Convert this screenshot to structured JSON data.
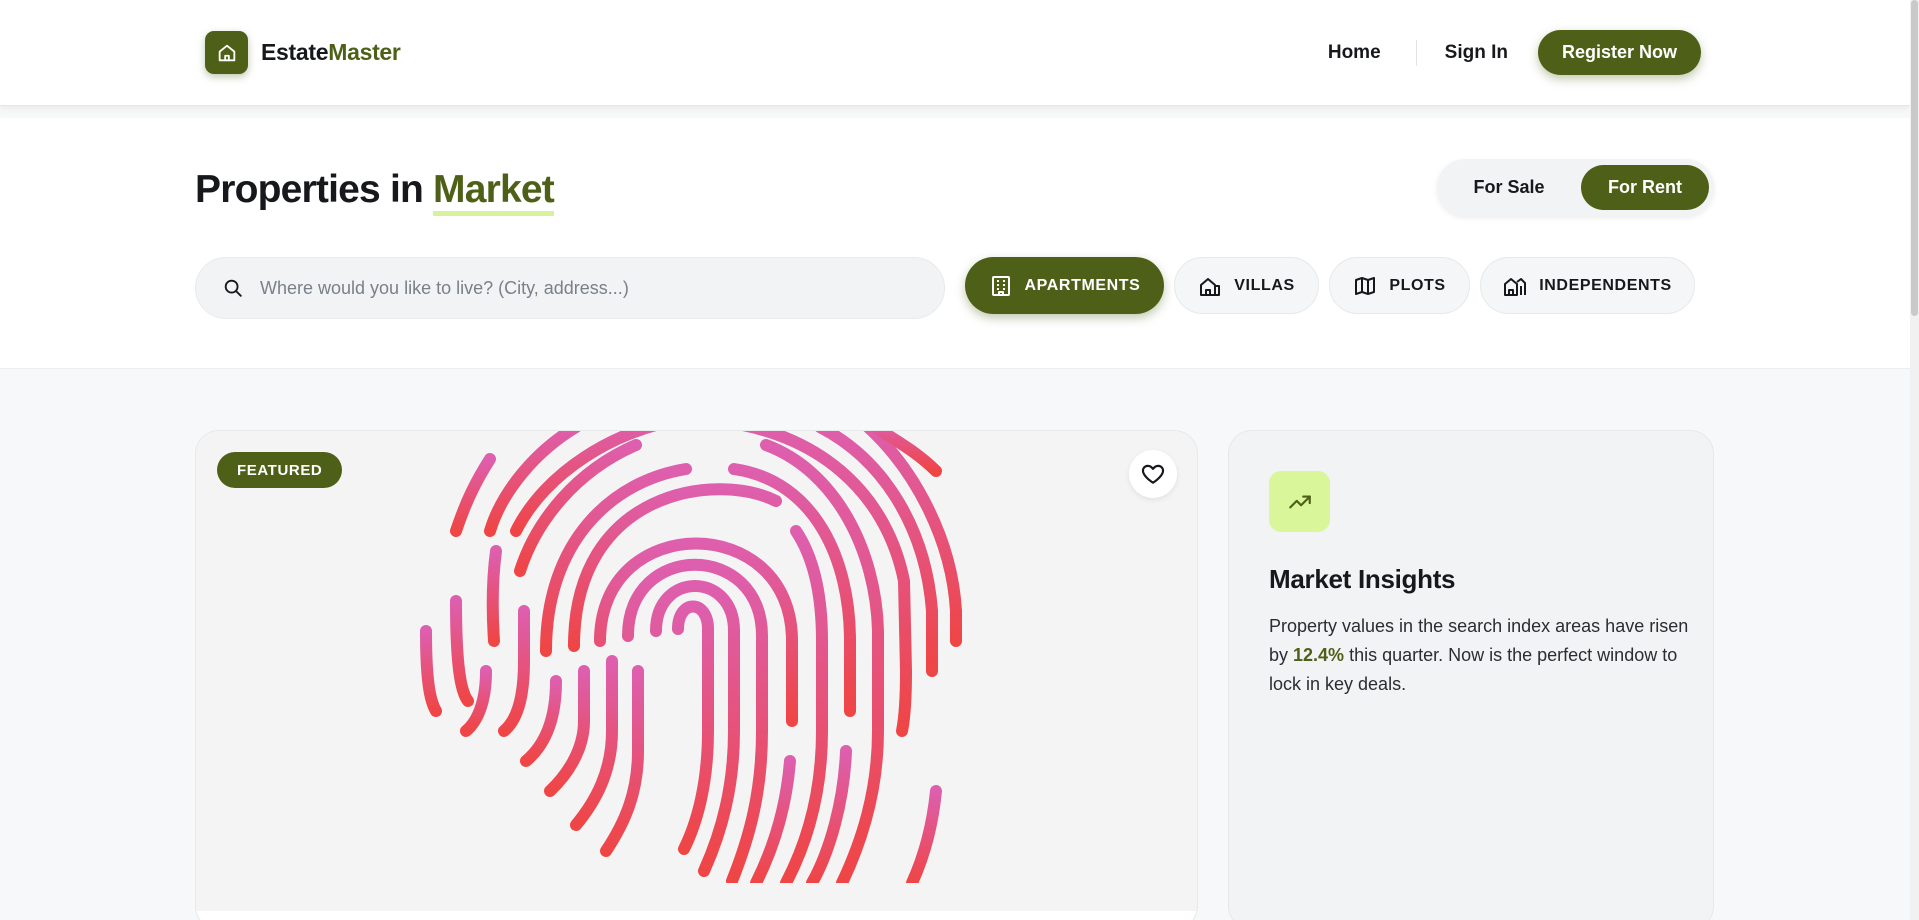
{
  "brand": {
    "name_part1": "Estate",
    "name_part2": "Master"
  },
  "nav": {
    "home": "Home",
    "signin": "Sign In",
    "register": "Register Now"
  },
  "hero": {
    "title_prefix": "Properties in ",
    "title_accent": "Market"
  },
  "toggle": {
    "sale": "For Sale",
    "rent": "For Rent",
    "selected": "For Rent"
  },
  "search": {
    "placeholder": "Where would you like to live? (City, address...)"
  },
  "categories": [
    {
      "label": "APARTMENTS",
      "icon": "building-icon",
      "active": true
    },
    {
      "label": "VILLAS",
      "icon": "villa-icon",
      "active": false
    },
    {
      "label": "PLOTS",
      "icon": "map-icon",
      "active": false
    },
    {
      "label": "INDEPENDENTS",
      "icon": "houses-icon",
      "active": false
    }
  ],
  "featured_card": {
    "badge": "FEATURED",
    "image": "fingerprint-image",
    "favorite_icon": "heart-icon"
  },
  "insights": {
    "icon": "trending-up-icon",
    "title": "Market Insights",
    "text_before": "Property values in the search index areas have risen by ",
    "highlight": "12.4%",
    "text_after": " this quarter. Now is the perfect window to lock in key deals."
  },
  "colors": {
    "brand": "#4e6018",
    "accent_light": "#d9f79a",
    "fingerprint_top": "#dd5fae",
    "fingerprint_bottom": "#ee4444"
  }
}
